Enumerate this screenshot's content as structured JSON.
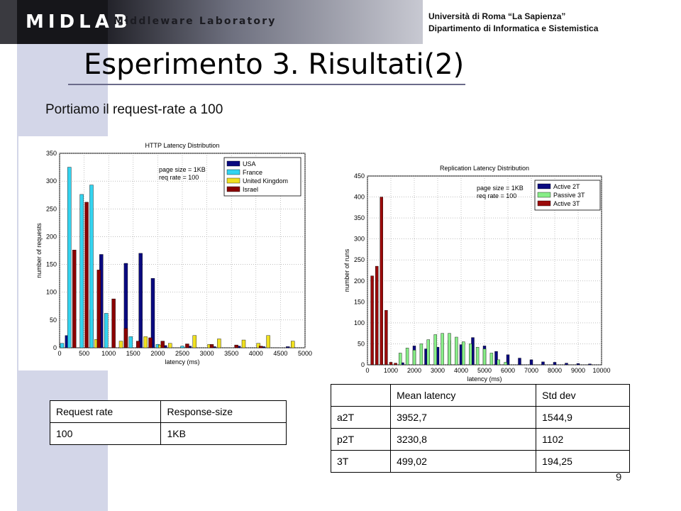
{
  "header": {
    "logo_text": "MIDLAB",
    "tagline": "Middleware Laboratory",
    "university_line1": "Università di Roma “La Sapienza”",
    "university_line2": "Dipartimento di Informatica e Sistemistica"
  },
  "slide": {
    "title": "Esperimento 3. Risultati(2)",
    "subtitle": "Portiamo il request-rate a 100",
    "page_number": "9"
  },
  "colors": {
    "usa": "#0a0a80",
    "france": "#33d4f0",
    "uk": "#f0e020",
    "israel": "#8b0000",
    "active2t": "#0a0a80",
    "passive3t": "#88ee88",
    "active3t": "#9b0a0a"
  },
  "chart_data": [
    {
      "type": "bar",
      "title": "HTTP Latency Distribution",
      "xlabel": "latency (ms)",
      "ylabel": "number of requests",
      "xlim": [
        0,
        5000
      ],
      "ylim": [
        0,
        350
      ],
      "xticks": [
        0,
        500,
        1000,
        1500,
        2000,
        2500,
        3000,
        3500,
        4000,
        4500,
        5000
      ],
      "yticks": [
        0,
        50,
        100,
        150,
        200,
        250,
        300,
        350
      ],
      "grid": true,
      "legend": "top-right",
      "annotation": [
        "page size = 1KB",
        "req rate = 100"
      ],
      "series": [
        {
          "name": "USA",
          "color": "#0a0a80",
          "points": [
            [
              150,
              22
            ],
            [
              650,
              68
            ],
            [
              850,
              168
            ],
            [
              1350,
              152
            ],
            [
              1650,
              170
            ],
            [
              1900,
              125
            ],
            [
              2150,
              4
            ],
            [
              2650,
              3
            ],
            [
              3150,
              2
            ],
            [
              3650,
              3
            ],
            [
              4150,
              2
            ],
            [
              4650,
              2
            ]
          ]
        },
        {
          "name": "France",
          "color": "#33d4f0",
          "points": [
            [
              50,
              8
            ],
            [
              200,
              325
            ],
            [
              450,
              276
            ],
            [
              650,
              293
            ],
            [
              950,
              62
            ],
            [
              1450,
              20
            ],
            [
              2000,
              6
            ],
            [
              2500,
              3
            ]
          ]
        },
        {
          "name": "United Kingdom",
          "color": "#f0e020",
          "points": [
            [
              750,
              15
            ],
            [
              1250,
              12
            ],
            [
              1750,
              20
            ],
            [
              2250,
              8
            ],
            [
              2750,
              22
            ],
            [
              3250,
              16
            ],
            [
              3750,
              14
            ],
            [
              4250,
              22
            ],
            [
              4750,
              12
            ],
            [
              2050,
              5
            ],
            [
              3050,
              6
            ],
            [
              4050,
              8
            ]
          ]
        },
        {
          "name": "Israel",
          "color": "#8b0000",
          "points": [
            [
              300,
              176
            ],
            [
              550,
              262
            ],
            [
              800,
              140
            ],
            [
              1100,
              88
            ],
            [
              1350,
              35
            ],
            [
              1600,
              12
            ],
            [
              1850,
              18
            ],
            [
              2100,
              12
            ],
            [
              2600,
              7
            ],
            [
              3100,
              6
            ],
            [
              3600,
              5
            ],
            [
              4100,
              3
            ]
          ]
        }
      ]
    },
    {
      "type": "bar",
      "title": "Replication Latency Distribution",
      "xlabel": "latency (ms)",
      "ylabel": "number of runs",
      "xlim": [
        0,
        10000
      ],
      "ylim": [
        0,
        450
      ],
      "xticks": [
        0,
        1000,
        2000,
        3000,
        4000,
        5000,
        6000,
        7000,
        8000,
        9000,
        10000
      ],
      "yticks": [
        0,
        50,
        100,
        150,
        200,
        250,
        300,
        350,
        400,
        450
      ],
      "grid": true,
      "legend": "top-right",
      "annotation": [
        "page size = 1KB",
        "req rate = 100"
      ],
      "series": [
        {
          "name": "Active 2T",
          "color": "#0a0a80",
          "points": [
            [
              1500,
              5
            ],
            [
              2000,
              45
            ],
            [
              2500,
              38
            ],
            [
              3000,
              42
            ],
            [
              3500,
              58
            ],
            [
              4000,
              48
            ],
            [
              4500,
              65
            ],
            [
              5000,
              45
            ],
            [
              5500,
              32
            ],
            [
              6000,
              24
            ],
            [
              6500,
              16
            ],
            [
              7000,
              12
            ],
            [
              7500,
              7
            ],
            [
              8000,
              6
            ],
            [
              8500,
              4
            ],
            [
              9000,
              3
            ],
            [
              9500,
              2
            ]
          ]
        },
        {
          "name": "Passive 3T",
          "color": "#88ee88",
          "points": [
            [
              1400,
              28
            ],
            [
              1700,
              40
            ],
            [
              2000,
              35
            ],
            [
              2300,
              50
            ],
            [
              2600,
              60
            ],
            [
              2900,
              72
            ],
            [
              3200,
              75
            ],
            [
              3500,
              75
            ],
            [
              3800,
              66
            ],
            [
              4100,
              55
            ],
            [
              4400,
              50
            ],
            [
              4700,
              42
            ],
            [
              5000,
              38
            ],
            [
              5300,
              28
            ],
            [
              5600,
              12
            ],
            [
              5900,
              6
            ]
          ]
        },
        {
          "name": "Active 3T",
          "color": "#9b0a0a",
          "points": [
            [
              200,
              212
            ],
            [
              400,
              235
            ],
            [
              600,
              400
            ],
            [
              800,
              130
            ],
            [
              1200,
              4
            ],
            [
              1000,
              6
            ]
          ]
        }
      ]
    }
  ],
  "table_request": {
    "headers": [
      "Request rate",
      "Response-size"
    ],
    "rows": [
      [
        "100",
        "1KB"
      ]
    ]
  },
  "table_latency": {
    "headers": [
      "",
      "Mean latency",
      "Std dev"
    ],
    "rows": [
      [
        "a2T",
        "3952,7",
        "1544,9"
      ],
      [
        "p2T",
        "3230,8",
        "1102"
      ],
      [
        "3T",
        "499,02",
        "194,25"
      ]
    ]
  }
}
